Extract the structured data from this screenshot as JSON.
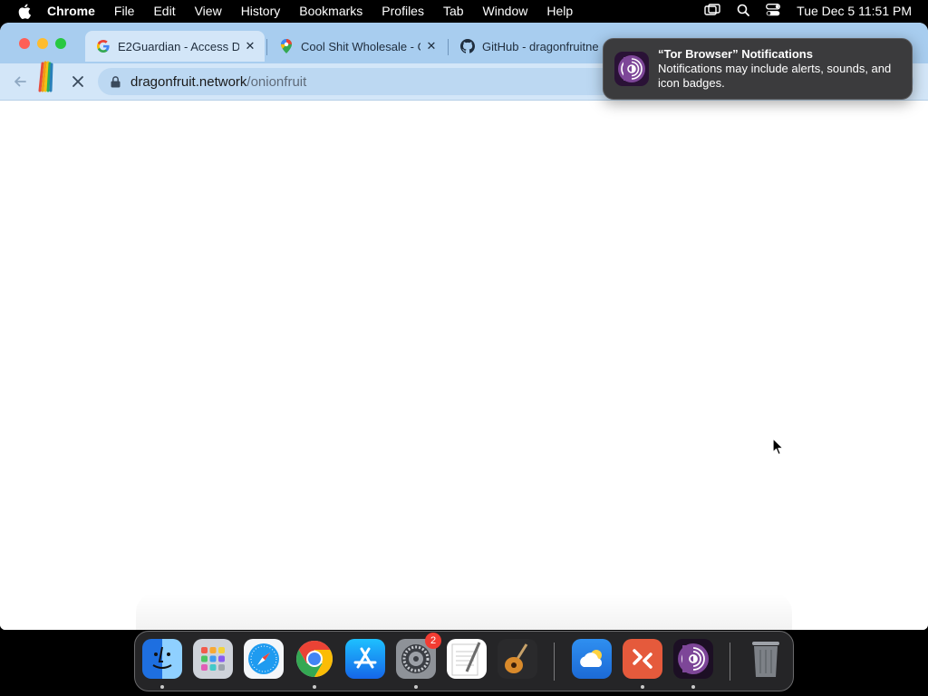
{
  "menubar": {
    "app_name": "Chrome",
    "menus": [
      "File",
      "Edit",
      "View",
      "History",
      "Bookmarks",
      "Profiles",
      "Tab",
      "Window",
      "Help"
    ],
    "clock": "Tue Dec 5  11:51 PM"
  },
  "browser": {
    "tabs": [
      {
        "title": "E2Guardian - Access D",
        "icon": "google-g-icon",
        "active": true
      },
      {
        "title": "Cool Shit Wholesale - G",
        "icon": "google-maps-pin-icon",
        "active": false
      },
      {
        "title": "GitHub - dragonfruitne",
        "icon": "github-icon",
        "active": false
      }
    ],
    "url": {
      "domain": "dragonfruit.network",
      "path": "/onionfruit"
    }
  },
  "notification": {
    "title": "“Tor Browser” Notifications",
    "body": "Notifications may include alerts, sounds, and icon badges."
  },
  "dock": {
    "items": [
      {
        "name": "Finder",
        "icon": "finder-icon",
        "running": true
      },
      {
        "name": "Launchpad",
        "icon": "launchpad-icon",
        "running": false
      },
      {
        "name": "Safari",
        "icon": "safari-icon",
        "running": false
      },
      {
        "name": "Google Chrome",
        "icon": "chrome-icon",
        "running": true
      },
      {
        "name": "App Store",
        "icon": "app-store-icon",
        "running": false
      },
      {
        "name": "System Settings",
        "icon": "system-settings-icon",
        "running": true,
        "badge": "2"
      },
      {
        "name": "TextEdit",
        "icon": "textedit-icon",
        "running": false
      },
      {
        "name": "GarageBand",
        "icon": "garageband-icon",
        "running": false
      },
      {
        "name": "Weather",
        "icon": "weather-icon",
        "running": false
      },
      {
        "name": "Remote Desktop",
        "icon": "remote-desktop-icon",
        "running": true
      },
      {
        "name": "Tor Browser",
        "icon": "tor-browser-icon",
        "running": true
      },
      {
        "name": "Trash",
        "icon": "trash-icon",
        "running": false
      }
    ]
  },
  "colors": {
    "tabstrip": "#a8cdef",
    "toolbar": "#d3e6f8",
    "badge": "#f23c32",
    "tor_purple": "#7d4698"
  }
}
